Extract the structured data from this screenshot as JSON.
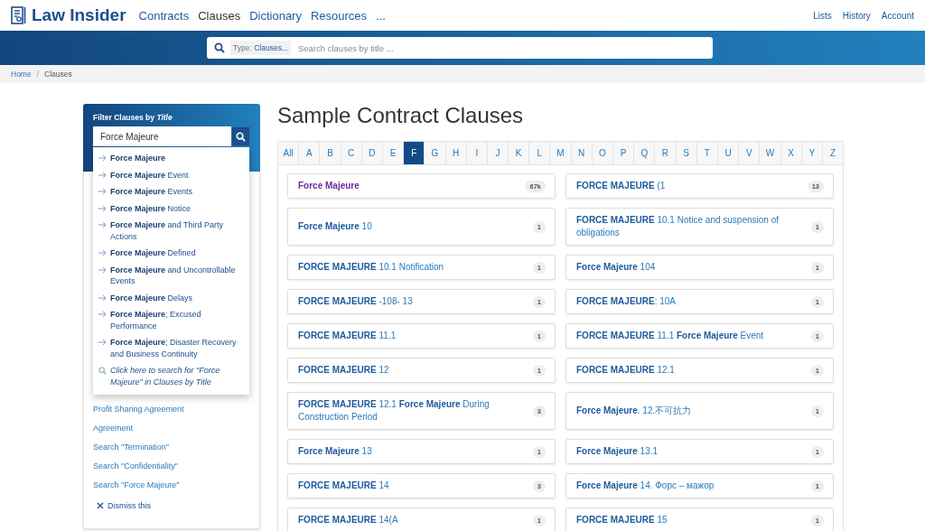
{
  "header": {
    "logo": "Law Insider",
    "nav": [
      {
        "label": "Contracts",
        "selected": false
      },
      {
        "label": "Clauses",
        "selected": true
      },
      {
        "label": "Dictionary",
        "selected": false
      },
      {
        "label": "Resources",
        "selected": false
      },
      {
        "label": "...",
        "selected": false
      }
    ],
    "account_links": [
      "Lists",
      "History",
      "Account"
    ]
  },
  "search": {
    "type_label": "Type:",
    "type_value": "Clauses...",
    "placeholder": "Search clauses by title ..."
  },
  "breadcrumb": {
    "items": [
      "Home",
      "Clauses"
    ],
    "separator": "/"
  },
  "filter": {
    "title": "Filter Clauses by *Title*",
    "value": "Force Majeure",
    "suggestions": [
      {
        "kind": "item",
        "text": "**Force Majeure**"
      },
      {
        "kind": "item",
        "text": "**Force Majeure** Event"
      },
      {
        "kind": "item",
        "text": "**Force Majeure** Events"
      },
      {
        "kind": "item",
        "text": "**Force Majeure** Notice"
      },
      {
        "kind": "item",
        "text": "**Force Majeure** and Third Party Actions"
      },
      {
        "kind": "item",
        "text": "**Force Majeure** Defined"
      },
      {
        "kind": "item",
        "text": "**Force Majeure** and Uncontrollable Events"
      },
      {
        "kind": "item",
        "text": "**Force Majeure** Delays"
      },
      {
        "kind": "item",
        "text": "**Force Majeure**; Excused Performance"
      },
      {
        "kind": "item",
        "text": "**Force Majeure**; Disaster Recovery and Business Continuity"
      },
      {
        "kind": "search",
        "text": "Click here to search for \"Force Majeure\" in Clauses by Title"
      }
    ]
  },
  "sidebar": {
    "links": [
      "Profit Sharing Agreement",
      "Agreement",
      "Search \"Termination\"",
      "Search \"Confidentiality\"",
      "Search \"Force Majeure\""
    ],
    "dismiss": "Dismiss this"
  },
  "heading": "Sample Contract Clauses",
  "letters": [
    {
      "label": "All",
      "selected": false
    },
    {
      "label": "A",
      "selected": false
    },
    {
      "label": "B",
      "selected": false
    },
    {
      "label": "C",
      "selected": false
    },
    {
      "label": "D",
      "selected": false
    },
    {
      "label": "E",
      "selected": false
    },
    {
      "label": "F",
      "selected": true
    },
    {
      "label": "G",
      "selected": false
    },
    {
      "label": "H",
      "selected": false
    },
    {
      "label": "I",
      "selected": false
    },
    {
      "label": "J",
      "selected": false
    },
    {
      "label": "K",
      "selected": false
    },
    {
      "label": "L",
      "selected": false
    },
    {
      "label": "M",
      "selected": false
    },
    {
      "label": "N",
      "selected": false
    },
    {
      "label": "O",
      "selected": false
    },
    {
      "label": "P",
      "selected": false
    },
    {
      "label": "Q",
      "selected": false
    },
    {
      "label": "R",
      "selected": false
    },
    {
      "label": "S",
      "selected": false
    },
    {
      "label": "T",
      "selected": false
    },
    {
      "label": "U",
      "selected": false
    },
    {
      "label": "V",
      "selected": false
    },
    {
      "label": "W",
      "selected": false
    },
    {
      "label": "X",
      "selected": false
    },
    {
      "label": "Y",
      "selected": false
    },
    {
      "label": "Z",
      "selected": false
    }
  ],
  "clause_rows": [
    {
      "cells": [
        {
          "title": "**Force Majeure**",
          "count": "67k",
          "visited": true
        },
        {
          "title": "**FORCE MAJEURE** (1",
          "count": "13",
          "visited": false
        }
      ]
    },
    {
      "cells": [
        {
          "title": "**Force Majeure** 10",
          "count": "1",
          "visited": false
        },
        {
          "title": "**FORCE MAJEURE** 10.1 Notice and suspension of obligations",
          "count": "1",
          "visited": false
        }
      ]
    },
    {
      "cells": [
        {
          "title": "**FORCE MAJEURE** 10.1 Notification",
          "count": "1",
          "visited": false
        },
        {
          "title": "**Force Majeure** 104",
          "count": "1",
          "visited": false
        }
      ]
    },
    {
      "cells": [
        {
          "title": "**FORCE MAJEURE** -108- 13",
          "count": "1",
          "visited": false
        },
        {
          "title": "**FORCE MAJEURE**: 10A",
          "count": "1",
          "visited": false
        }
      ]
    },
    {
      "cells": [
        {
          "title": "**FORCE MAJEURE** 11.1",
          "count": "1",
          "visited": false
        },
        {
          "title": "**FORCE MAJEURE** 11.1 **Force Majeure** Event",
          "count": "1",
          "visited": false
        }
      ]
    },
    {
      "cells": [
        {
          "title": "**FORCE MAJEURE** 12",
          "count": "1",
          "visited": false
        },
        {
          "title": "**FORCE MAJEURE** 12.1",
          "count": "1",
          "visited": false
        }
      ]
    },
    {
      "cells": [
        {
          "title": "**FORCE MAJEURE** 12.1 **Force Majeure** During Construction Period",
          "count": "3",
          "visited": false
        },
        {
          "title": "**Force Majeure**. 12.不可抗力",
          "count": "1",
          "visited": false
        }
      ]
    },
    {
      "cells": [
        {
          "title": "**Force Majeure** 13",
          "count": "1",
          "visited": false
        },
        {
          "title": "**Force Majeure** 13.1",
          "count": "1",
          "visited": false
        }
      ]
    },
    {
      "cells": [
        {
          "title": "**FORCE MAJEURE** 14",
          "count": "3",
          "visited": false
        },
        {
          "title": "**Force Majeure** 14. Форс – мажор",
          "count": "1",
          "visited": false
        }
      ]
    },
    {
      "cells": [
        {
          "title": "**FORCE MAJEURE** 14(A",
          "count": "1",
          "visited": false
        },
        {
          "title": "**FORCE MAJEURE** 15",
          "count": "1",
          "visited": false
        }
      ]
    }
  ]
}
